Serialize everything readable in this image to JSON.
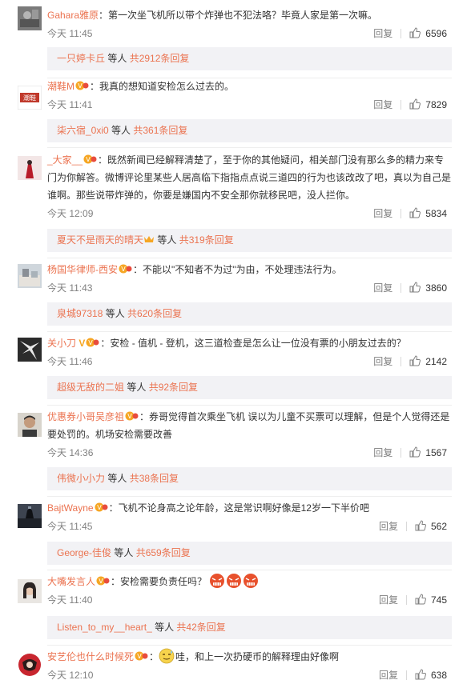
{
  "comments": [
    {
      "user": "Gahara雅原",
      "vip": false,
      "text": "第一次坐飞机所以带个炸弹也不犯法咯？毕竟人家是第一次嘛。",
      "time": "今天 11:45",
      "reply_label": "回复",
      "likes": "6596",
      "sub_name": "一只婷卡丘",
      "sub_deng": " 等人 ",
      "sub_total": "共2912条回复"
    },
    {
      "user": "潮鞋M",
      "vip": true,
      "text": "我真的想知道安检怎么过去的。",
      "time": "今天 11:41",
      "reply_label": "回复",
      "likes": "7829",
      "sub_name": "柒六宿_0xi0",
      "sub_deng": " 等人 ",
      "sub_total": "共361条回复"
    },
    {
      "user": "_大家__",
      "vip": true,
      "text": "既然新闻已经解释清楚了，至于你的其他疑问，相关部门没有那么多的精力来专门为你解答。微博评论里某些人居高临下指指点点说三道四的行为也该改改了吧，真以为自己是谁啊。那些说带炸弹的，你要是嫌国内不安全那你就移民吧，没人拦你。",
      "time": "今天 12:09",
      "reply_label": "回复",
      "likes": "5834",
      "sub_name": "夏天不是雨天的晴天",
      "sub_deng": " 等人 ",
      "sub_total": "共319条回复"
    },
    {
      "user": "杨国华律师-西安",
      "vip": true,
      "text": "不能以\"不知者不为过\"为由，不处理违法行为。",
      "time": "今天 11:43",
      "reply_label": "回复",
      "likes": "3860",
      "sub_name": "泉城97318",
      "sub_deng": " 等人 ",
      "sub_total": "共620条回复"
    },
    {
      "user": "关小刀",
      "vip": true,
      "text": "安检 - 值机 - 登机，这三道检查是怎么让一位没有票的小朋友过去的？",
      "time": "今天 11:46",
      "reply_label": "回复",
      "likes": "2142",
      "sub_name": "超级无敌的二姐",
      "sub_deng": " 等人 ",
      "sub_total": "共92条回复"
    },
    {
      "user": "优惠券小哥吴彦祖",
      "vip": true,
      "text": "券哥觉得首次乘坐飞机 误以为儿童不买票可以理解，但是个人觉得还是要处罚的。机场安检需要改善",
      "time": "今天 14:36",
      "reply_label": "回复",
      "likes": "1567",
      "sub_name": "伟微小小力",
      "sub_deng": " 等人 ",
      "sub_total": "共38条回复"
    },
    {
      "user": "BajtWayne",
      "vip": true,
      "text": "飞机不论身高之论年龄，这是常识啊好像是12岁一下半价吧",
      "time": "今天 11:45",
      "reply_label": "回复",
      "likes": "562",
      "sub_name": "George-佳俊",
      "sub_deng": " 等人 ",
      "sub_total": "共659条回复"
    },
    {
      "user": "大嘴发言人",
      "vip": true,
      "text": "安检需要负责任吗？",
      "time": "今天 11:40",
      "reply_label": "回复",
      "likes": "745",
      "sub_name": "Listen_to_my__heart_",
      "sub_deng": " 等人 ",
      "sub_total": "共42条回复"
    },
    {
      "user": "安艺伦也什么时候死",
      "vip": true,
      "text": "哇，和上一次扔硬币的解释理由好像啊",
      "time": "今天 12:10",
      "reply_label": "回复",
      "likes": "638"
    }
  ],
  "icons": {
    "like": "thumbs-up-icon",
    "vip": "vip-badge-icon",
    "emoji_angry": "angry-face-emoji",
    "emoji_sweat": "sweat-face-emoji",
    "crown": "crown-icon"
  },
  "colors": {
    "username": "#eb7350",
    "meta": "#808080",
    "reply_bg": "#f2f2f5"
  }
}
